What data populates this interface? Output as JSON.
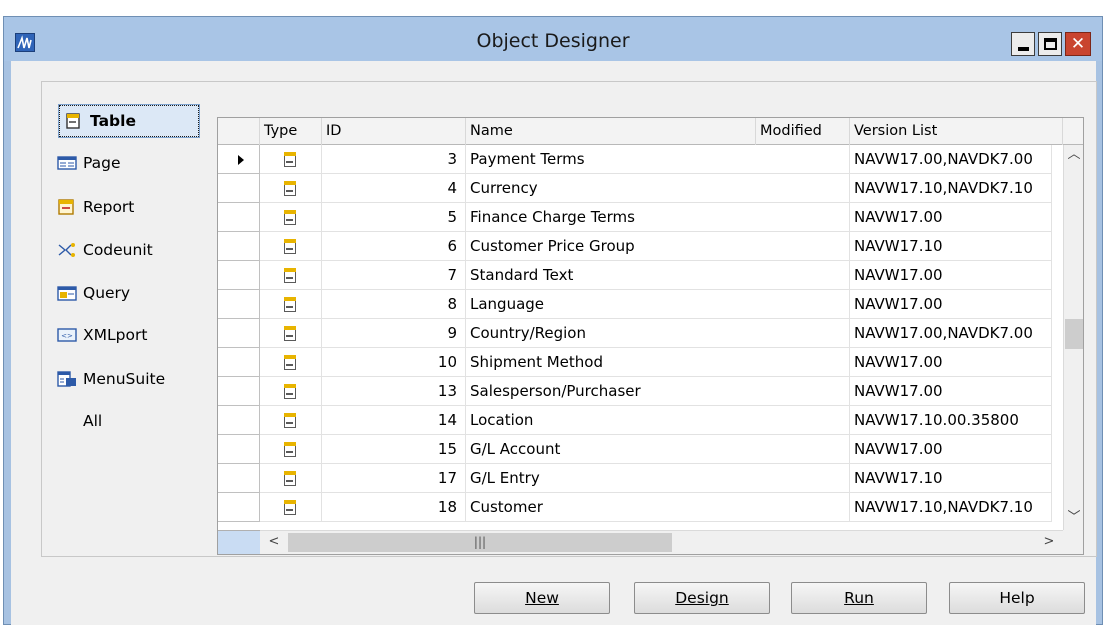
{
  "window": {
    "title": "Object Designer"
  },
  "object_types": [
    {
      "label": "Table",
      "icon": "table-icon",
      "selected": true
    },
    {
      "label": "Page",
      "icon": "page-icon",
      "selected": false
    },
    {
      "label": "Report",
      "icon": "report-icon",
      "selected": false
    },
    {
      "label": "Codeunit",
      "icon": "codeunit-icon",
      "selected": false
    },
    {
      "label": "Query",
      "icon": "query-icon",
      "selected": false
    },
    {
      "label": "XMLport",
      "icon": "xmlport-icon",
      "selected": false
    },
    {
      "label": "MenuSuite",
      "icon": "menusuite-icon",
      "selected": false
    },
    {
      "label": "All",
      "icon": "",
      "selected": false
    }
  ],
  "grid": {
    "columns": {
      "type": "Type",
      "id": "ID",
      "name": "Name",
      "modified": "Modified",
      "version": "Version List"
    },
    "rows": [
      {
        "id": "3",
        "name": "Payment Terms",
        "modified": "",
        "version": "NAVW17.00,NAVDK7.00",
        "current": true
      },
      {
        "id": "4",
        "name": "Currency",
        "modified": "",
        "version": "NAVW17.10,NAVDK7.10"
      },
      {
        "id": "5",
        "name": "Finance Charge Terms",
        "modified": "",
        "version": "NAVW17.00"
      },
      {
        "id": "6",
        "name": "Customer Price Group",
        "modified": "",
        "version": "NAVW17.10"
      },
      {
        "id": "7",
        "name": "Standard Text",
        "modified": "",
        "version": "NAVW17.00"
      },
      {
        "id": "8",
        "name": "Language",
        "modified": "",
        "version": "NAVW17.00"
      },
      {
        "id": "9",
        "name": "Country/Region",
        "modified": "",
        "version": "NAVW17.00,NAVDK7.00"
      },
      {
        "id": "10",
        "name": "Shipment Method",
        "modified": "",
        "version": "NAVW17.00"
      },
      {
        "id": "13",
        "name": "Salesperson/Purchaser",
        "modified": "",
        "version": "NAVW17.00"
      },
      {
        "id": "14",
        "name": "Location",
        "modified": "",
        "version": "NAVW17.10.00.35800"
      },
      {
        "id": "15",
        "name": "G/L Account",
        "modified": "",
        "version": "NAVW17.00"
      },
      {
        "id": "17",
        "name": "G/L Entry",
        "modified": "",
        "version": "NAVW17.10"
      },
      {
        "id": "18",
        "name": "Customer",
        "modified": "",
        "version": "NAVW17.10,NAVDK7.10"
      }
    ]
  },
  "buttons": {
    "new": "New",
    "design": "Design",
    "run": "Run",
    "help": "Help"
  },
  "colors": {
    "titlebar": "#a9c5e6",
    "selected_item": "#dce8f6",
    "close_button": "#c9442f"
  }
}
